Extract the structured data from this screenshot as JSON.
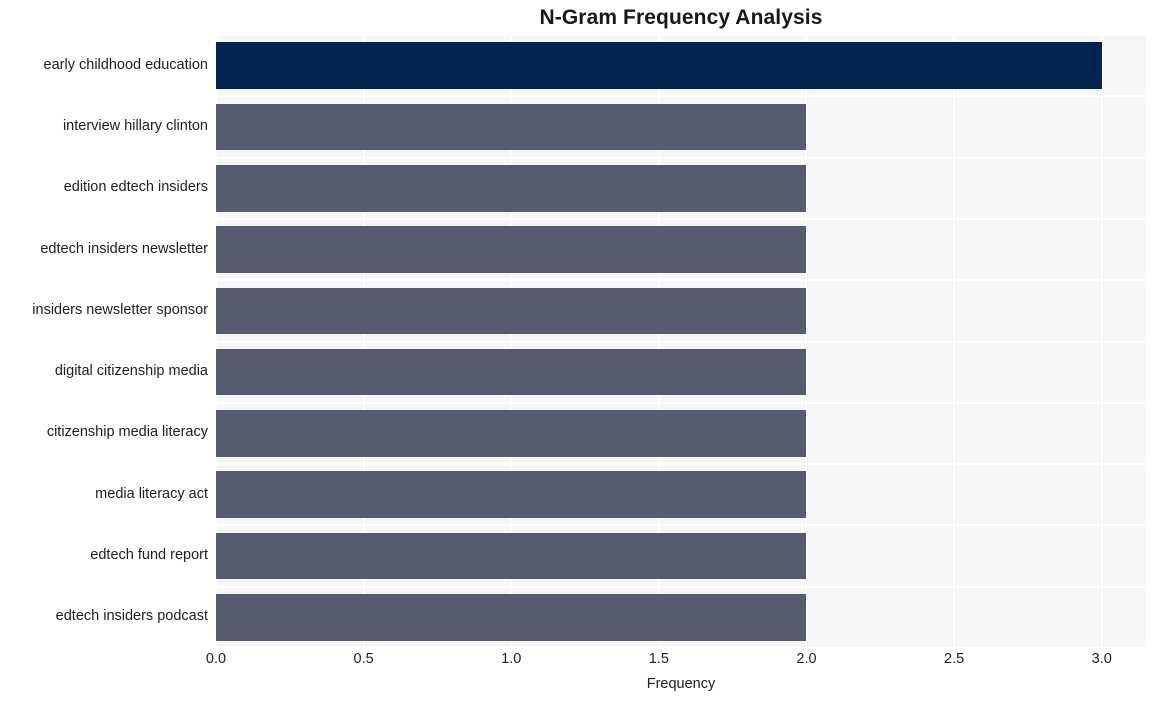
{
  "chart_data": {
    "type": "bar",
    "orientation": "horizontal",
    "title": "N-Gram Frequency Analysis",
    "xlabel": "Frequency",
    "ylabel": "",
    "categories": [
      "early childhood education",
      "interview hillary clinton",
      "edition edtech insiders",
      "edtech insiders newsletter",
      "insiders newsletter sponsor",
      "digital citizenship media",
      "citizenship media literacy",
      "media literacy act",
      "edtech fund report",
      "edtech insiders podcast"
    ],
    "values": [
      3,
      2,
      2,
      2,
      2,
      2,
      2,
      2,
      2,
      2
    ],
    "xlim": [
      0,
      3.15
    ],
    "xticks": [
      0.0,
      0.5,
      1.0,
      1.5,
      2.0,
      2.5,
      3.0
    ],
    "xticklabels": [
      "0.0",
      "0.5",
      "1.0",
      "1.5",
      "2.0",
      "2.5",
      "3.0"
    ],
    "grid": true,
    "legend": false,
    "bar_colors": [
      "#00244f",
      "#565c6d",
      "#565c6d",
      "#565c6d",
      "#565c6d",
      "#565c6d",
      "#565c6d",
      "#565c6d",
      "#565c6d",
      "#565c6d"
    ],
    "highlight_color": "#00244f",
    "default_color": "#565c6d",
    "plot_background": "#f6f6f7",
    "gridline_color": "#ffffff",
    "figure_background": "#ffffff",
    "text_color": "#1f1f1f"
  }
}
